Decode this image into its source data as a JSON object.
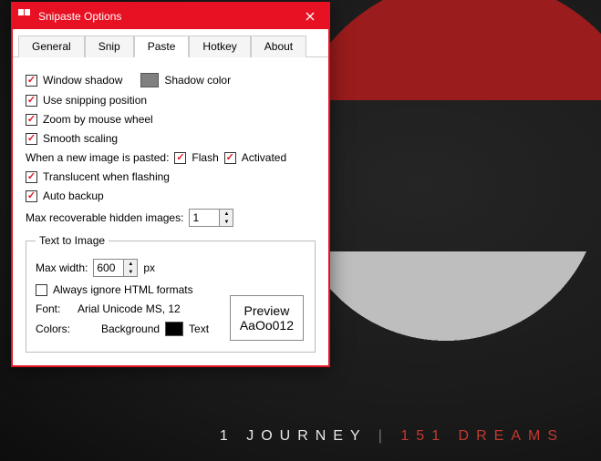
{
  "wallpaper": {
    "line1": "1 JOURNEY",
    "sep": " | ",
    "line2": "151 DREAMS"
  },
  "window": {
    "title": "Snipaste Options",
    "tabs": [
      "General",
      "Snip",
      "Paste",
      "Hotkey",
      "About"
    ],
    "active_tab": 2,
    "paste": {
      "window_shadow": "Window shadow",
      "shadow_color": "Shadow color",
      "use_snipping_position": "Use snipping position",
      "zoom_by_mouse_wheel": "Zoom by mouse wheel",
      "smooth_scaling": "Smooth scaling",
      "when_pasted": "When a new image is pasted:",
      "flash": "Flash",
      "activated": "Activated",
      "translucent": "Translucent when flashing",
      "auto_backup": "Auto backup",
      "max_recoverable": "Max recoverable hidden images:",
      "max_recoverable_value": "1",
      "text_to_image": {
        "legend": "Text to Image",
        "max_width_label": "Max width:",
        "max_width_value": "600",
        "px": "px",
        "always_ignore_html": "Always ignore HTML formats",
        "font_label": "Font:",
        "font_value": "Arial Unicode MS, 12",
        "colors_label": "Colors:",
        "background_label": "Background",
        "text_label": "Text",
        "preview_l1": "Preview",
        "preview_l2": "AaOo012"
      }
    }
  }
}
